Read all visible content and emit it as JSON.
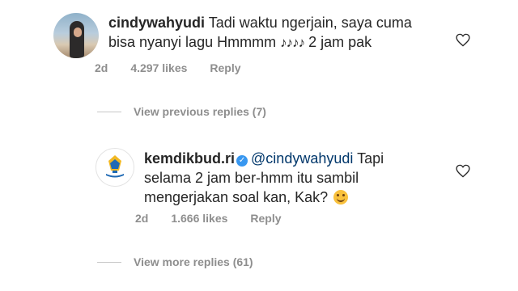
{
  "comments": [
    {
      "username": "cindywahyudi",
      "line1": "Tadi waktu ngerjain, saya cuma",
      "line2_before": "bisa nyanyi lagu Hmmmm",
      "notes": "♪♪♪♪",
      "line2_after": "2 jam pak",
      "age": "2d",
      "likes": "4.297 likes",
      "reply": "Reply",
      "avatar": "profile-photo-beach"
    },
    {
      "username": "kemdikbud.ri",
      "mention": "@cindywahyudi",
      "line1_after": "Tapi",
      "line2": "selama 2 jam ber-hmm itu sambil",
      "line3": "mengerjakan soal kan, Kak?",
      "age": "2d",
      "likes": "1.666 likes",
      "reply": "Reply",
      "verified_icon": "verified-badge-icon"
    }
  ],
  "view_previous": "View previous replies (7)",
  "view_more": "View more replies (61)",
  "colors": {
    "text": "#262626",
    "muted": "#8e8e8e",
    "mention": "#00376b",
    "verified": "#3897f0"
  }
}
